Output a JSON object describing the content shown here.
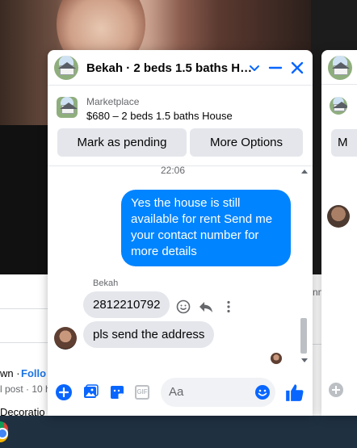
{
  "chat": {
    "title": "Bekah · 2 beds 1.5 baths H…",
    "listing": {
      "category": "Marketplace",
      "title": "$680 – 2 beds 1.5 baths House",
      "mark_pending_label": "Mark as pending",
      "more_options_label": "More Options"
    },
    "messages": {
      "timestamp": "22:06",
      "outgoing_text": "Yes the house is still available for rent Send me your contact number for more details",
      "sender_name": "Bekah",
      "incoming": [
        {
          "text": "2812210792"
        },
        {
          "text": "pls send the address"
        }
      ]
    },
    "composer": {
      "placeholder": "Aa",
      "gif_label": "GIF"
    }
  },
  "chat2": {
    "button_partial": "M"
  },
  "background": {
    "name_fragment": "wn ·",
    "follow_fragment": "Follo",
    "post_fragment": "l post · 10 h",
    "decoration_fragment": "Decoratio",
    "right_fragment": "nn"
  },
  "colors": {
    "messenger_blue": "#0084ff",
    "accent_blue": "#0866ff",
    "bubble_gray": "#e4e6eb",
    "taskbar": "#1f3041"
  },
  "icons": {
    "header": [
      "chevron-down-icon",
      "minimize-icon",
      "close-icon"
    ],
    "composer": [
      "add-icon",
      "photo-icon",
      "sticker-icon",
      "gif-icon",
      "emoji-icon",
      "thumbs-up-icon"
    ],
    "message_actions": [
      "react-emoji-icon",
      "reply-icon",
      "more-icon"
    ]
  }
}
